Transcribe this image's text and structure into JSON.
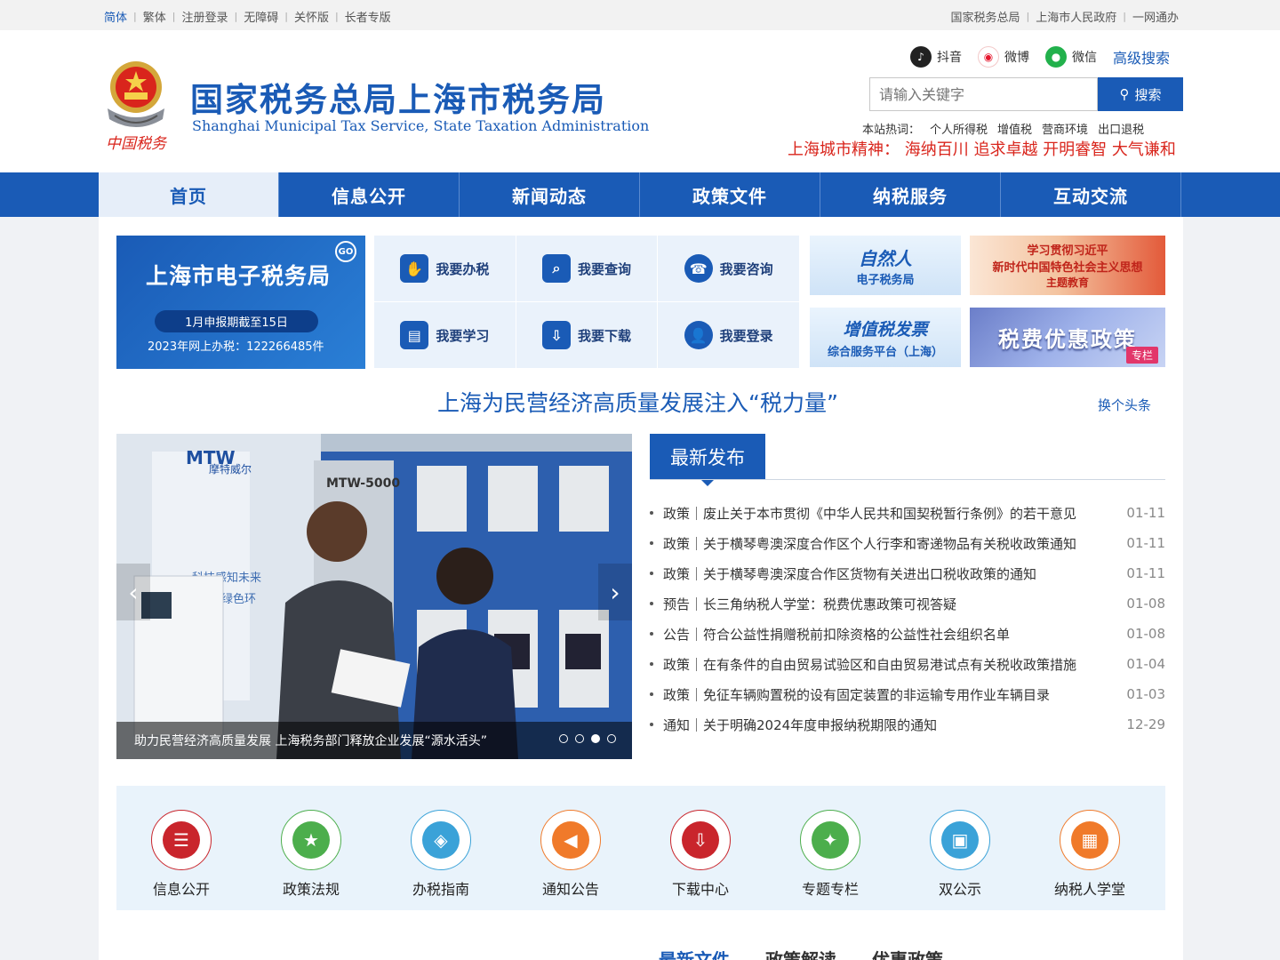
{
  "topbar": {
    "left": [
      {
        "label": "简体",
        "active": true
      },
      {
        "label": "繁体"
      },
      {
        "label": "注册登录"
      },
      {
        "label": "无障碍"
      },
      {
        "label": "关怀版"
      },
      {
        "label": "长者专版"
      }
    ],
    "right": [
      "国家税务总局",
      "上海市人民政府",
      "一网通办"
    ]
  },
  "header": {
    "title": "国家税务总局上海市税务局",
    "subtitle": "Shanghai Municipal Tax Service, State Taxation Administration",
    "emblem_text": "中国税务",
    "social": [
      {
        "label": "抖音",
        "icon": "douyin-icon",
        "color": "#222222"
      },
      {
        "label": "微博",
        "icon": "weibo-icon",
        "color": "#e6162d"
      },
      {
        "label": "微信",
        "icon": "wechat-icon",
        "color": "#22b14c"
      }
    ],
    "advanced_search": "高级搜索",
    "search_placeholder": "请输入关键字",
    "search_button": "搜索",
    "hot_label": "本站热词：",
    "hot_words": [
      "个人所得税",
      "增值税",
      "营商环境",
      "出口退税"
    ],
    "spirit": "上海城市精神：  海纳百川 追求卓越 开明睿智 大气谦和"
  },
  "nav": [
    {
      "label": "首页",
      "active": true
    },
    {
      "label": "信息公开"
    },
    {
      "label": "新闻动态"
    },
    {
      "label": "政策文件"
    },
    {
      "label": "纳税服务"
    },
    {
      "label": "互动交流"
    }
  ],
  "etax": {
    "title": "上海市电子税务局",
    "go": "GO",
    "notice": "1月申报期截至15日",
    "stat": "2023年网上办税：122266485件"
  },
  "services": [
    {
      "label": "我要办税",
      "icon": "tax-handling-icon"
    },
    {
      "label": "我要查询",
      "icon": "query-icon"
    },
    {
      "label": "我要咨询",
      "icon": "consult-headset-icon"
    },
    {
      "label": "我要学习",
      "icon": "study-book-icon"
    },
    {
      "label": "我要下载",
      "icon": "download-icon"
    },
    {
      "label": "我要登录",
      "icon": "user-login-icon"
    }
  ],
  "tiles": {
    "natural_a": "自然人",
    "natural_b": "电子税务局",
    "invoice_a": "增值税发票",
    "invoice_b": "综合服务平台（上海）",
    "study_a": "学习贯彻习近平",
    "study_b": "新时代中国特色社会主义思想",
    "study_c": "主题教育",
    "policy_a": "税费优惠政策",
    "policy_tag": "专栏"
  },
  "headline": "上海为民营经济高质量发展注入“税力量”",
  "change_headline": "换个头条",
  "slider": {
    "caption": "助力民营经济高质量发展 上海税务部门释放企业发展“源水活头”",
    "dots": 4,
    "active_dot": 2,
    "photo_text_brand": "MTW",
    "photo_text_brand_cn": "摩特威尔",
    "photo_text_model": "MTW-5000",
    "photo_text_slogan": "科技感知未来",
    "photo_text_slogan2": "绿色环"
  },
  "latest": {
    "tab": "最新发布",
    "items": [
      {
        "text": "政策｜废止关于本市贯彻《中华人民共和国契税暂行条例》的若干意见",
        "date": "01-11"
      },
      {
        "text": "政策｜关于横琴粤澳深度合作区个人行李和寄递物品有关税收政策通知",
        "date": "01-11"
      },
      {
        "text": "政策｜关于横琴粤澳深度合作区货物有关进出口税收政策的通知",
        "date": "01-11"
      },
      {
        "text": "预告｜长三角纳税人学堂：税费优惠政策可视答疑",
        "date": "01-08"
      },
      {
        "text": "公告｜符合公益性捐赠税前扣除资格的公益性社会组织名单",
        "date": "01-08"
      },
      {
        "text": "政策｜在有条件的自由贸易试验区和自由贸易港试点有关税收政策措施",
        "date": "01-04"
      },
      {
        "text": "政策｜免征车辆购置税的设有固定装置的非运输专用作业车辆目录",
        "date": "01-03"
      },
      {
        "text": "通知｜关于明确2024年度申报纳税期限的通知",
        "date": "12-29"
      }
    ]
  },
  "quick": [
    {
      "label": "信息公开",
      "icon": "info-list-icon",
      "color": "#c9252c"
    },
    {
      "label": "政策法规",
      "icon": "policy-book-icon",
      "color": "#4cae4c"
    },
    {
      "label": "办税指南",
      "icon": "compass-icon",
      "color": "#3aa2d8"
    },
    {
      "label": "通知公告",
      "icon": "speaker-icon",
      "color": "#f07a2a"
    },
    {
      "label": "下载中心",
      "icon": "download-box-icon",
      "color": "#c9252c"
    },
    {
      "label": "专题专栏",
      "icon": "star-list-icon",
      "color": "#4cae4c"
    },
    {
      "label": "双公示",
      "icon": "board-icon",
      "color": "#3aa2d8"
    },
    {
      "label": "纳税人学堂",
      "icon": "classroom-icon",
      "color": "#f07a2a"
    }
  ],
  "bottom_tabs": [
    {
      "label": "最新文件",
      "active": true
    },
    {
      "label": "政策解读"
    },
    {
      "label": "优惠政策"
    }
  ]
}
